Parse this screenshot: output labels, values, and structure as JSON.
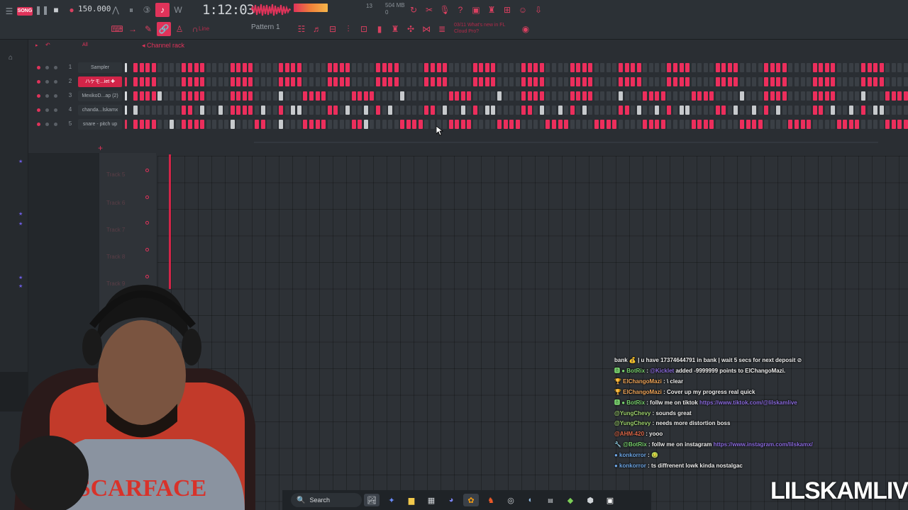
{
  "toolbar": {
    "song_mode": "SONG",
    "tempo": "150.000",
    "time": "1:12:03",
    "cpu": "13",
    "memory": "504 MB",
    "memory_sub": "0",
    "pattern": "Pattern 1",
    "snap": "Line",
    "news": "03/11  What's new in FL Cloud Pro?"
  },
  "channel_rack": {
    "title": "Channel rack",
    "filter": "All",
    "channels": [
      {
        "num": "1",
        "name": "Sampler",
        "selected": false
      },
      {
        "num": "2",
        "name": "ハケモ...iet ✚",
        "selected": true
      },
      {
        "num": "3",
        "name": "MexikoD...ap (2)",
        "selected": false
      },
      {
        "num": "4",
        "name": "chanda...lskamx",
        "selected": false
      },
      {
        "num": "5",
        "name": "snare - pitch up",
        "selected": false
      }
    ]
  },
  "playlist": {
    "tracks": [
      "Track 5",
      "Track 6",
      "Track 7",
      "Track 8",
      "Track 9"
    ]
  },
  "chat": [
    {
      "parts": [
        {
          "t": "bank 💰 | u have 17374644791 in bank | wait 5 secs for next deposit ⊘",
          "c": ""
        }
      ]
    },
    {
      "parts": [
        {
          "t": "🅱 ● BotRix",
          "c": "u-bot"
        },
        {
          "t": " : ",
          "c": ""
        },
        {
          "t": "@Kicklet",
          "c": "link"
        },
        {
          "t": " added -9999999 points to ElChangoMazi.",
          "c": ""
        }
      ]
    },
    {
      "parts": [
        {
          "t": "🏆 ElChangoMazi",
          "c": "u-chango"
        },
        {
          "t": " : \\ clear",
          "c": ""
        }
      ]
    },
    {
      "parts": [
        {
          "t": "🏆 ElChangoMazi",
          "c": "u-chango"
        },
        {
          "t": " : Cover up my progress real quick",
          "c": ""
        }
      ]
    },
    {
      "parts": [
        {
          "t": "🅱 ● BotRix",
          "c": "u-bot"
        },
        {
          "t": " : follw me on tiktok ",
          "c": ""
        },
        {
          "t": "https://www.tiktok.com/@lilskamlive",
          "c": "link"
        }
      ]
    },
    {
      "parts": [
        {
          "t": "@YungChevy",
          "c": "u-yung"
        },
        {
          "t": " : sounds great",
          "c": ""
        }
      ]
    },
    {
      "parts": [
        {
          "t": "@YungChevy",
          "c": "u-yung"
        },
        {
          "t": " : needs more distortion boss",
          "c": ""
        }
      ]
    },
    {
      "parts": [
        {
          "t": "@AHM-420",
          "c": "u-ahm"
        },
        {
          "t": " : yooo",
          "c": ""
        }
      ]
    },
    {
      "parts": [
        {
          "t": "🔧 @BotRix",
          "c": "u-bot"
        },
        {
          "t": " : follw me on instagram ",
          "c": ""
        },
        {
          "t": "https://www.instagram.com/lilskamx/",
          "c": "link"
        }
      ]
    },
    {
      "parts": [
        {
          "t": "● konkorror",
          "c": "u-kon"
        },
        {
          "t": " : 🤢",
          "c": ""
        }
      ]
    },
    {
      "parts": [
        {
          "t": "● konkorror",
          "c": "u-kon"
        },
        {
          "t": " : ts diffrenent lowk kinda nostalgac",
          "c": ""
        }
      ]
    }
  ],
  "taskbar": {
    "search_label": "Search"
  },
  "overlay": {
    "streamer_logo": "LILSKAMLIVE"
  },
  "colors": {
    "accent": "#e0335a",
    "step_on": "#ec2e5c",
    "step_off": "#3a3f45",
    "panel": "#2a2e33"
  }
}
